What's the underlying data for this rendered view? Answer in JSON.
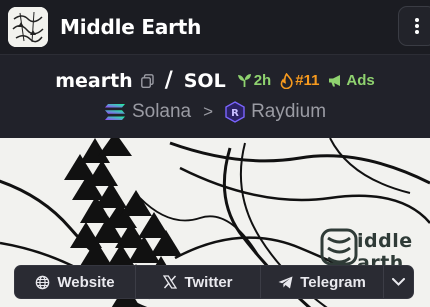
{
  "header": {
    "title": "Middle Earth",
    "logo_icon": "middle-earth-logo",
    "menu_icon": "vertical-ellipsis-icon"
  },
  "pair": {
    "base_symbol": "mearth",
    "separator": "/",
    "quote_symbol": "SOL",
    "age": "2h",
    "rank": "#11",
    "ads_label": "Ads",
    "chain": "Solana",
    "dex": "Raydium",
    "colors": {
      "green": "#8fd26f",
      "orange": "#f79a1e"
    }
  },
  "banner": {
    "line1": "iddle",
    "line2": "arth"
  },
  "links": {
    "website": "Website",
    "twitter": "Twitter",
    "telegram": "Telegram"
  }
}
